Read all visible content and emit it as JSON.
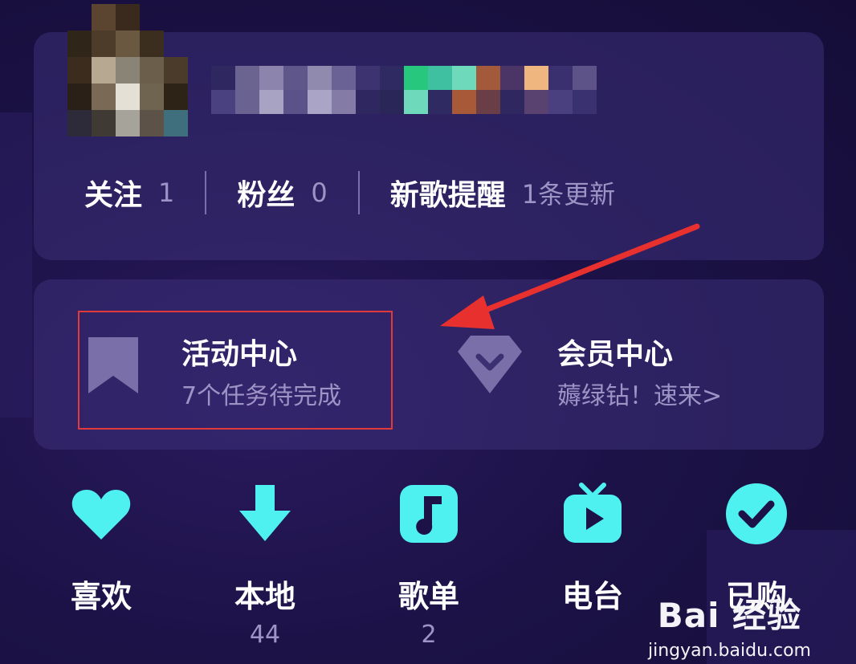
{
  "profile": {
    "stats": [
      {
        "label": "关注",
        "value": "1"
      },
      {
        "label": "粉丝",
        "value": "0"
      },
      {
        "label": "新歌提醒",
        "value": "1条更新"
      }
    ]
  },
  "tiles": {
    "activity": {
      "title": "活动中心",
      "subtitle": "7个任务待完成"
    },
    "member": {
      "title": "会员中心",
      "subtitle": "薅绿钻！速来>"
    }
  },
  "nav": [
    {
      "label": "喜欢",
      "count": "",
      "icon": "heart-icon"
    },
    {
      "label": "本地",
      "count": "44",
      "icon": "download-icon"
    },
    {
      "label": "歌单",
      "count": "2",
      "icon": "music-note-icon"
    },
    {
      "label": "电台",
      "count": "",
      "icon": "radio-tv-icon"
    },
    {
      "label": "已购",
      "count": "",
      "icon": "check-circle-icon"
    }
  ],
  "watermark": {
    "logo": "Bai 经验",
    "url": "jingyan.baidu.com"
  },
  "colors": {
    "accent": "#4ff0f0",
    "highlight": "#e23a3a",
    "muted_text": "#9d94c6"
  }
}
